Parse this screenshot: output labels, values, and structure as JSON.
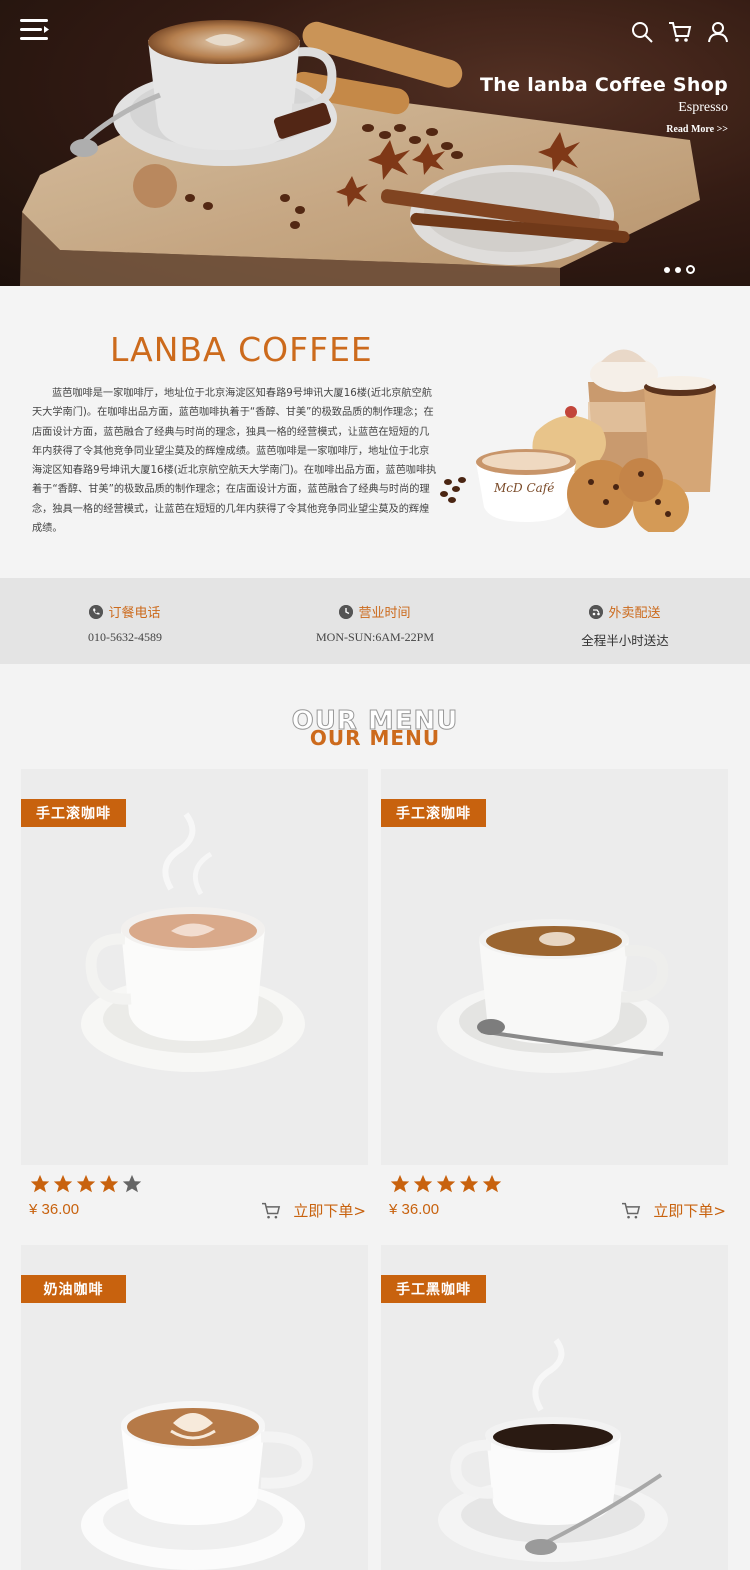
{
  "header": {
    "icons": [
      "hamburger-menu-icon",
      "search-icon",
      "cart-icon",
      "user-icon"
    ]
  },
  "hero": {
    "title": "The lanba Coffee Shop",
    "subtitle": "Espresso",
    "link": "Read More >>",
    "slides": 3,
    "active_slide": 3
  },
  "about": {
    "title": "LANBA COFFEE",
    "text": "蓝芭咖啡是一家咖啡厅，地址位于北京海淀区知春路9号坤讯大厦16楼(近北京航空航天大学南门)。在咖啡出品方面，蓝芭咖啡执着于“香醇、甘美”的极致品质的制作理念；在店面设计方面，蓝芭融合了经典与时尚的理念，独具一格的经营模式，让蓝芭在短短的几年内获得了令其他竞争同业望尘莫及的辉煌成绩。蓝芭咖啡是一家咖啡厅，地址位于北京海淀区知春路9号坤讯大厦16楼(近北京航空航天大学南门)。在咖啡出品方面，蓝芭咖啡执着于“香醇、甘美”的极致品质的制作理念；在店面设计方面，蓝芭融合了经典与时尚的理念，独具一格的经营模式，让蓝芭在短短的几年内获得了令其他竞争同业望尘莫及的辉煌成绩。",
    "cup_logo_text": "McD Café"
  },
  "info": [
    {
      "icon": "phone-icon",
      "label": "订餐电话",
      "value": "010-5632-4589"
    },
    {
      "icon": "clock-icon",
      "label": "营业时间",
      "value": "MON-SUN:6AM-22PM"
    },
    {
      "icon": "delivery-icon",
      "label": "外卖配送",
      "value": "全程半小时送达"
    }
  ],
  "menu": {
    "heading_shadow": "OUR MENU",
    "heading": "OUR MENU",
    "products": [
      {
        "tag": "手工滚咖啡",
        "rating": 4,
        "price": "¥ 36.00",
        "order_label": "立即下单>"
      },
      {
        "tag": "手工滚咖啡",
        "rating": 5,
        "price": "¥ 36.00",
        "order_label": "立即下单>"
      },
      {
        "tag": "奶油咖啡"
      },
      {
        "tag": "手工黑咖啡"
      }
    ]
  },
  "colors": {
    "accent": "#cc6a1c",
    "tag": "#c8620e",
    "star_on": "#c8620e",
    "star_off": "#666666"
  }
}
